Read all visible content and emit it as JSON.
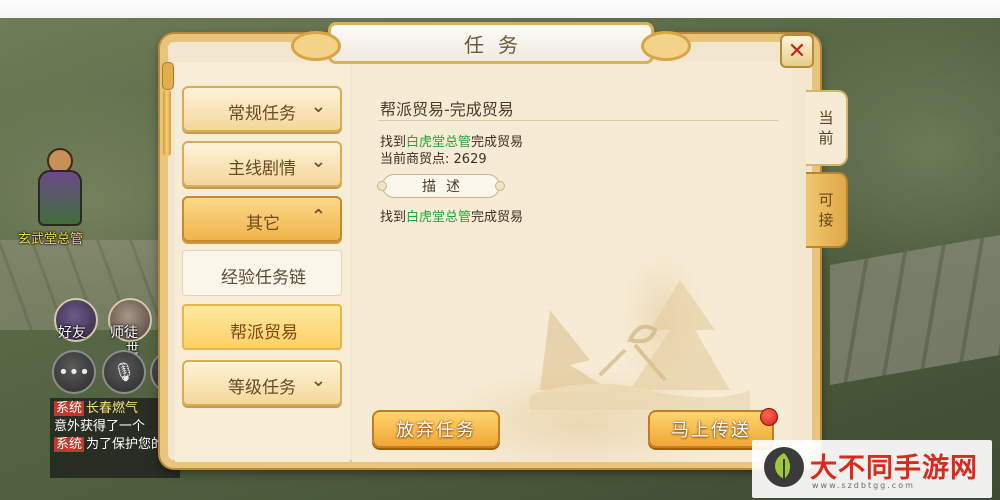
{
  "dialog": {
    "title": "任务",
    "title_deco": "",
    "close_icon": "close-icon"
  },
  "sidebar": {
    "categories": [
      {
        "label": "常规任务",
        "chevron": "chevron-down-icon",
        "chev_glyph": "⌄"
      },
      {
        "label": "主线剧情",
        "chevron": "chevron-down-icon",
        "chev_glyph": "⌄"
      },
      {
        "label": "其它",
        "chevron": "chevron-up-icon",
        "chev_glyph": "⌃"
      },
      {
        "label": "等级任务",
        "chevron": "chevron-down-icon",
        "chev_glyph": "⌄"
      }
    ],
    "sub_items": [
      {
        "label": "经验任务链"
      },
      {
        "label": "帮派贸易"
      }
    ]
  },
  "quest": {
    "title": "帮派贸易-完成贸易",
    "line1_prefix": "找到",
    "line1_npc": "白虎堂总管",
    "line1_suffix": "完成贸易",
    "points_label": "当前商贸点:",
    "points_value": "2629",
    "desc_label": "描述",
    "desc_prefix": "找到",
    "desc_npc": "白虎堂总管",
    "desc_suffix": "完成贸易"
  },
  "buttons": {
    "abandon": "放弃任务",
    "teleport": "马上传送"
  },
  "tabs": {
    "current": "当前",
    "available": "可接"
  },
  "hud": {
    "npc_name": "玄武堂总管",
    "friends": "好友",
    "master": "师徒",
    "world": "世",
    "chat_tag": "系统",
    "chat_line1": "长春燃气",
    "chat_line2": "意外获得了一个",
    "chat_line3": "为了保护您的"
  },
  "watermark": {
    "brand": "大不同手游网",
    "url": "www.szdbtgg.com"
  },
  "colors": {
    "npc_link": "#2aa43a",
    "button_orange": "#f0a635",
    "close_red": "#c0261e",
    "watermark_red": "#d92a1f"
  }
}
